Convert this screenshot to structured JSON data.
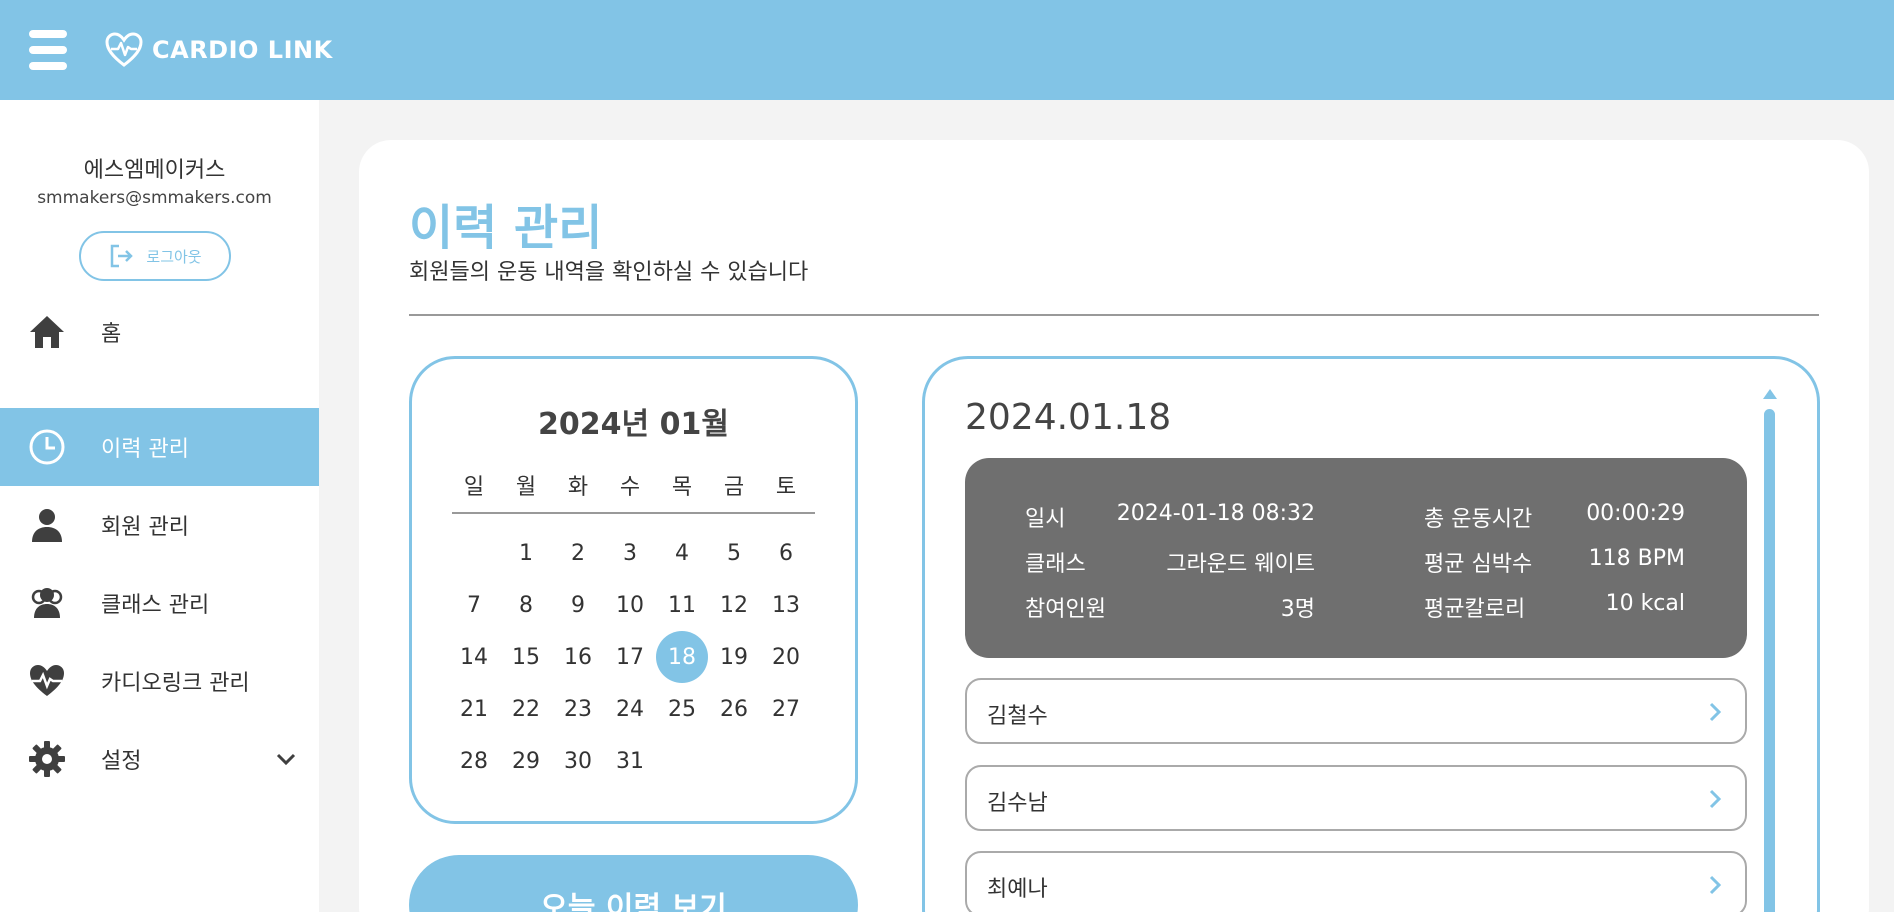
{
  "header": {
    "brand": "CARDIO LINK"
  },
  "profile": {
    "name": "에스엠메이커스",
    "email": "smmakers@smmakers.com",
    "logout_label": "로그아웃"
  },
  "nav": {
    "items": [
      {
        "label": "홈",
        "icon": "home-icon"
      },
      {
        "label": "이력 관리",
        "icon": "clock-icon",
        "active": true
      },
      {
        "label": "회원 관리",
        "icon": "user-icon"
      },
      {
        "label": "클래스 관리",
        "icon": "group-icon"
      },
      {
        "label": "카디오링크 관리",
        "icon": "heartbeat-icon"
      },
      {
        "label": "설정",
        "icon": "gear-icon"
      }
    ]
  },
  "page": {
    "title": "이력 관리",
    "subtitle": "회원들의 운동 내역을 확인하실 수 있습니다"
  },
  "calendar": {
    "title": "2024년 01월",
    "weekdays": [
      "일",
      "월",
      "화",
      "수",
      "목",
      "금",
      "토"
    ],
    "days": [
      "",
      "1",
      "2",
      "3",
      "4",
      "5",
      "6",
      "7",
      "8",
      "9",
      "10",
      "11",
      "12",
      "13",
      "14",
      "15",
      "16",
      "17",
      "18",
      "19",
      "20",
      "21",
      "22",
      "23",
      "24",
      "25",
      "26",
      "27",
      "28",
      "29",
      "30",
      "31"
    ],
    "selected": "18",
    "today_button": "오늘 이력 보기"
  },
  "detail": {
    "date": "2024.01.18",
    "summary": {
      "datetime_label": "일시",
      "datetime_value": "2024-01-18 08:32",
      "class_label": "클래스",
      "class_value": "그라운드 웨이트",
      "participants_label": "참여인원",
      "participants_value": "3명",
      "total_time_label": "총 운동시간",
      "total_time_value": "00:00:29",
      "avg_hr_label": "평균 심박수",
      "avg_hr_value": "118 BPM",
      "avg_cal_label": "평균칼로리",
      "avg_cal_value": "10 kcal"
    },
    "members": [
      "김철수",
      "김수남",
      "최예나"
    ]
  },
  "colors": {
    "accent": "#82c4e6",
    "summary_bg": "#6f6f6f"
  }
}
